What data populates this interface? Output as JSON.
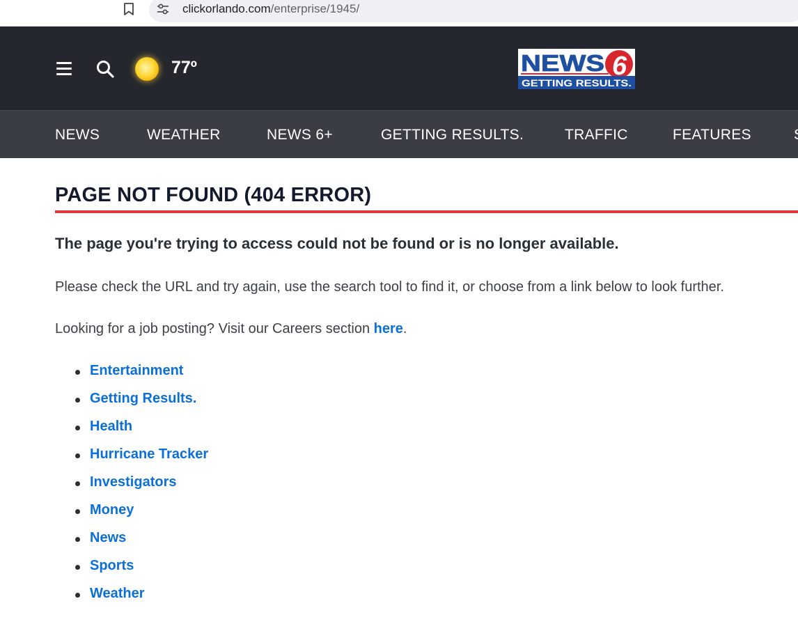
{
  "browser": {
    "url_host": "clickorlando.com",
    "url_path": "/enterprise/1945/"
  },
  "header": {
    "temperature": "77º",
    "weather_icon": "sun-icon",
    "logo": {
      "line1": "NEWS",
      "numeral": "6",
      "line2": "GETTING RESULTS.",
      "colors": {
        "blue": "#1f4fa0",
        "red": "#d7262e",
        "white": "#ffffff"
      }
    }
  },
  "nav": {
    "items": [
      {
        "label": "NEWS"
      },
      {
        "label": "WEATHER"
      },
      {
        "label": "NEWS 6+"
      },
      {
        "label": "GETTING RESULTS."
      },
      {
        "label": "TRAFFIC"
      },
      {
        "label": "FEATURES"
      },
      {
        "label": "S"
      }
    ]
  },
  "main": {
    "title": "PAGE NOT FOUND (404 ERROR)",
    "lead": "The page you're trying to access could not be found or is no longer available.",
    "instructions": "Please check the URL and try again, use the search tool to find it, or choose from a link below to look further.",
    "careers_prefix": "Looking for a job posting? Visit our Careers section ",
    "careers_link": "here",
    "careers_suffix": ".",
    "links": [
      {
        "label": "Entertainment"
      },
      {
        "label": "Getting Results."
      },
      {
        "label": "Health"
      },
      {
        "label": "Hurricane Tracker"
      },
      {
        "label": "Investigators"
      },
      {
        "label": "Money"
      },
      {
        "label": "News"
      },
      {
        "label": "Sports"
      },
      {
        "label": "Weather"
      }
    ]
  },
  "colors": {
    "header_bg": "#24272d",
    "nav_bg": "#3a3d44",
    "accent_red": "#e0393e",
    "link_blue": "#0b6fd8"
  }
}
